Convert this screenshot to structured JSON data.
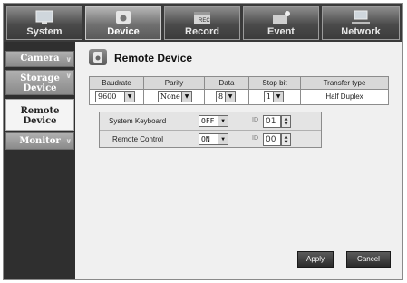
{
  "top_tabs": [
    {
      "label": "System",
      "icon": "monitor-icon",
      "active": false
    },
    {
      "label": "Device",
      "icon": "camera-icon",
      "active": true
    },
    {
      "label": "Record",
      "icon": "record-icon",
      "active": false
    },
    {
      "label": "Event",
      "icon": "event-icon",
      "active": false
    },
    {
      "label": "Network",
      "icon": "network-icon",
      "active": false
    }
  ],
  "side_menu": [
    {
      "label": "Camera",
      "active": false
    },
    {
      "label": "Storage Device",
      "active": false
    },
    {
      "label": "Remote Device",
      "active": true
    },
    {
      "label": "Monitor",
      "active": false
    }
  ],
  "page": {
    "title": "Remote Device",
    "icon": "remote-device-icon"
  },
  "serial": {
    "headers": [
      "Baudrate",
      "Parity",
      "Data",
      "Stop bit",
      "Transfer type"
    ],
    "baudrate": "9600",
    "parity": "None",
    "data": "8",
    "stop_bit": "1",
    "transfer_type": "Half Duplex"
  },
  "devices": [
    {
      "label": "System Keyboard",
      "state": "OFF",
      "id_label": "ID",
      "id_value": "01"
    },
    {
      "label": "Remote Control",
      "state": "ON",
      "id_label": "ID",
      "id_value": "00"
    }
  ],
  "buttons": {
    "apply": "Apply",
    "cancel": "Cancel"
  },
  "colors": {
    "menu_dark": "#2f2f2f",
    "tab_active": "#707070",
    "button": "#2a2a2a"
  }
}
